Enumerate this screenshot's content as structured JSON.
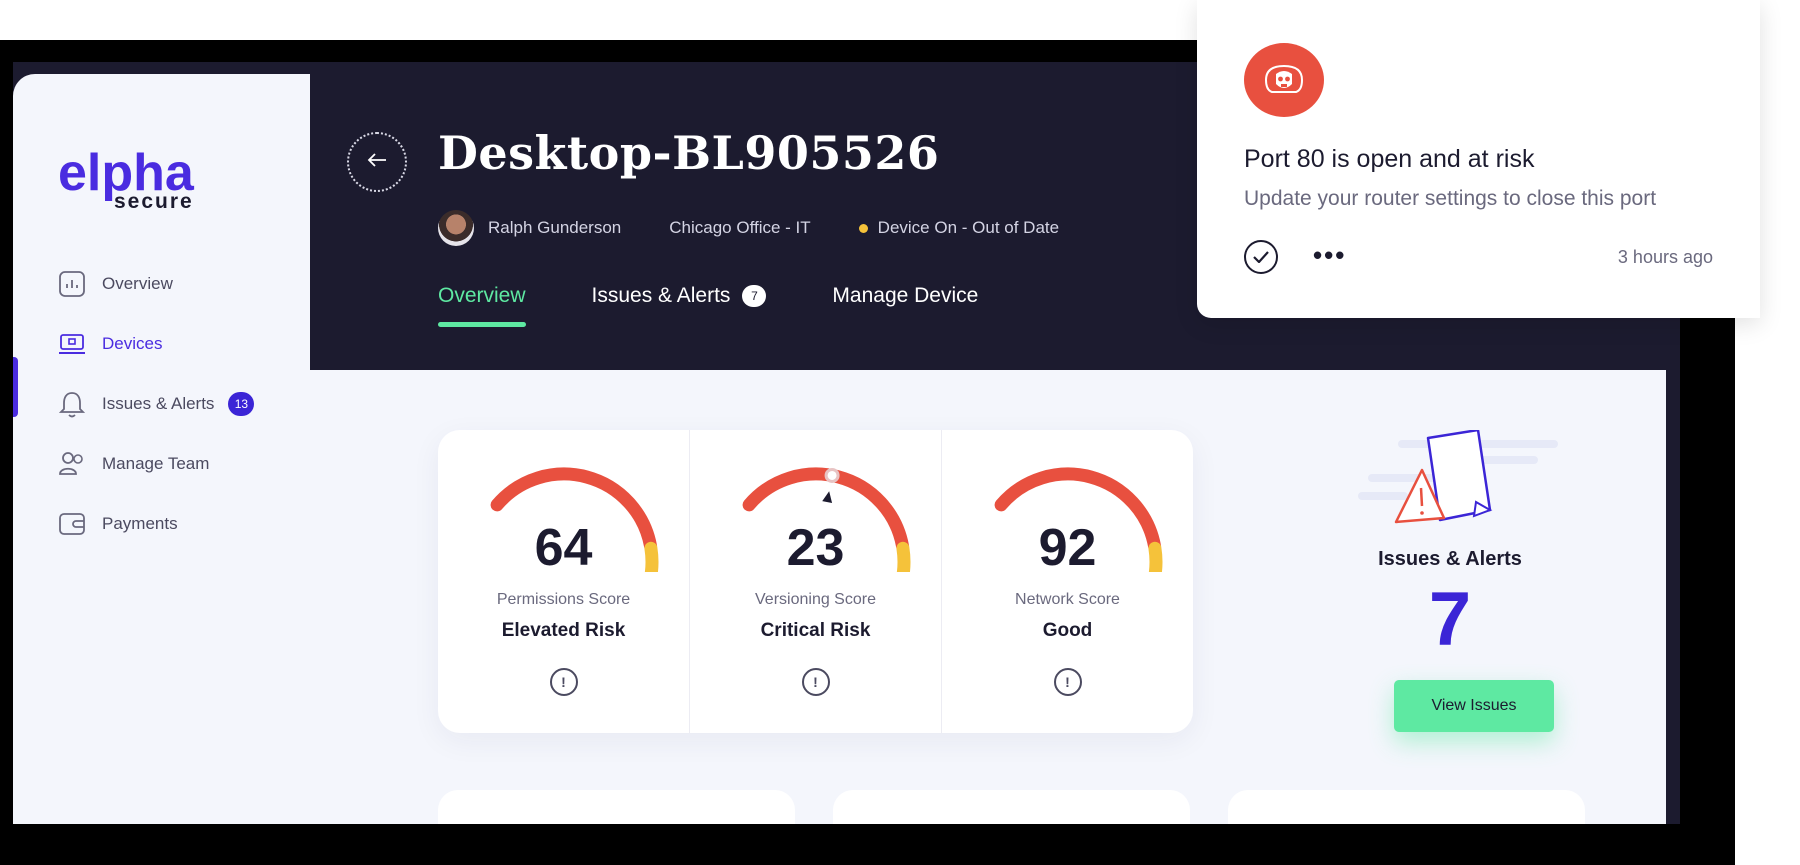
{
  "brand": {
    "logo_main": "elpha",
    "logo_sub": "secure"
  },
  "sidebar": {
    "items": [
      {
        "label": "Overview",
        "icon": "chart-icon",
        "active": false
      },
      {
        "label": "Devices",
        "icon": "laptop-icon",
        "active": true
      },
      {
        "label": "Issues & Alerts",
        "icon": "bell-icon",
        "badge": "13"
      },
      {
        "label": "Manage Team",
        "icon": "users-icon"
      },
      {
        "label": "Payments",
        "icon": "wallet-icon"
      }
    ]
  },
  "header": {
    "title": "Desktop-BL905526",
    "user": "Ralph Gunderson",
    "location": "Chicago Office - IT",
    "status": "Device On - Out of Date",
    "status_color": "#f5c23a"
  },
  "tabs": [
    {
      "label": "Overview",
      "active": true
    },
    {
      "label": "Issues & Alerts",
      "badge": "7"
    },
    {
      "label": "Manage Device"
    }
  ],
  "scores": [
    {
      "value": "64",
      "label": "Permissions Score",
      "risk": "Elevated Risk",
      "level": 0.64
    },
    {
      "value": "23",
      "label": "Versioning Score",
      "risk": "Critical Risk",
      "level": 0.23
    },
    {
      "value": "92",
      "label": "Network Score",
      "risk": "Good",
      "level": 0.92
    }
  ],
  "issues_panel": {
    "title": "Issues & Alerts",
    "count": "7",
    "button": "View Issues"
  },
  "notification": {
    "title": "Port 80 is open and at risk",
    "body": "Update your router settings to close this port",
    "time": "3 hours ago",
    "icon": "skull-icon"
  },
  "colors": {
    "accent": "#4a2ce0",
    "green": "#5ee9a2",
    "red": "#e8503f",
    "yellow": "#f5c23a",
    "blue": "#5ec2f0",
    "navy": "#1c1b2f"
  }
}
